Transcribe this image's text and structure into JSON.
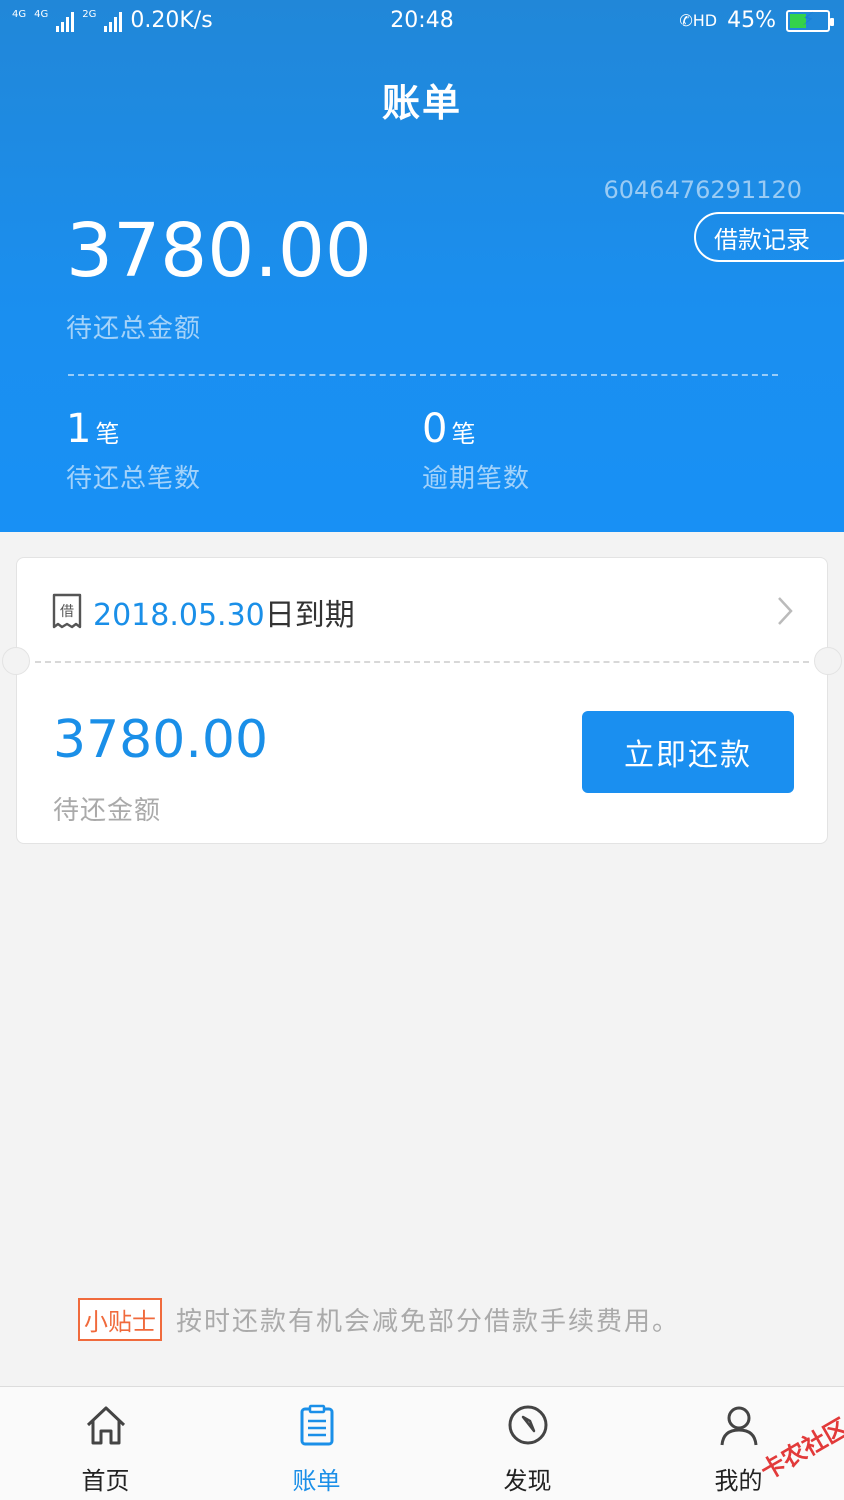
{
  "status_bar": {
    "network1": "4G",
    "network2": "4G",
    "network3": "2G",
    "speed": "0.20K/s",
    "time": "20:48",
    "hd": "HD",
    "battery_percent": "45%",
    "battery_level": 0.45
  },
  "header": {
    "title": "账单",
    "account_number": "6046476291120",
    "records_button": "借款记录",
    "total_amount": "3780.00",
    "total_amount_label": "待还总金额",
    "stats": [
      {
        "value": "1",
        "unit": "笔",
        "label": "待还总笔数"
      },
      {
        "value": "0",
        "unit": "笔",
        "label": "逾期笔数"
      }
    ]
  },
  "bill_card": {
    "icon_char": "借",
    "due_date": "2018.05.30",
    "due_suffix": "日到期",
    "amount": "3780.00",
    "amount_label": "待还金额",
    "repay_button": "立即还款"
  },
  "tip": {
    "badge": "小贴士",
    "text": "按时还款有机会减免部分借款手续费用。"
  },
  "tabbar": {
    "tabs": [
      {
        "label": "首页",
        "icon": "home-icon"
      },
      {
        "label": "账单",
        "icon": "bill-icon"
      },
      {
        "label": "发现",
        "icon": "compass-icon"
      },
      {
        "label": "我的",
        "icon": "user-icon"
      }
    ],
    "active_index": 1
  },
  "watermark": "卡农社区",
  "colors": {
    "primary": "#1a8ff0",
    "header_top": "#2187d8",
    "tip_accent": "#f06a3c",
    "page_bg": "#f3f3f3"
  }
}
